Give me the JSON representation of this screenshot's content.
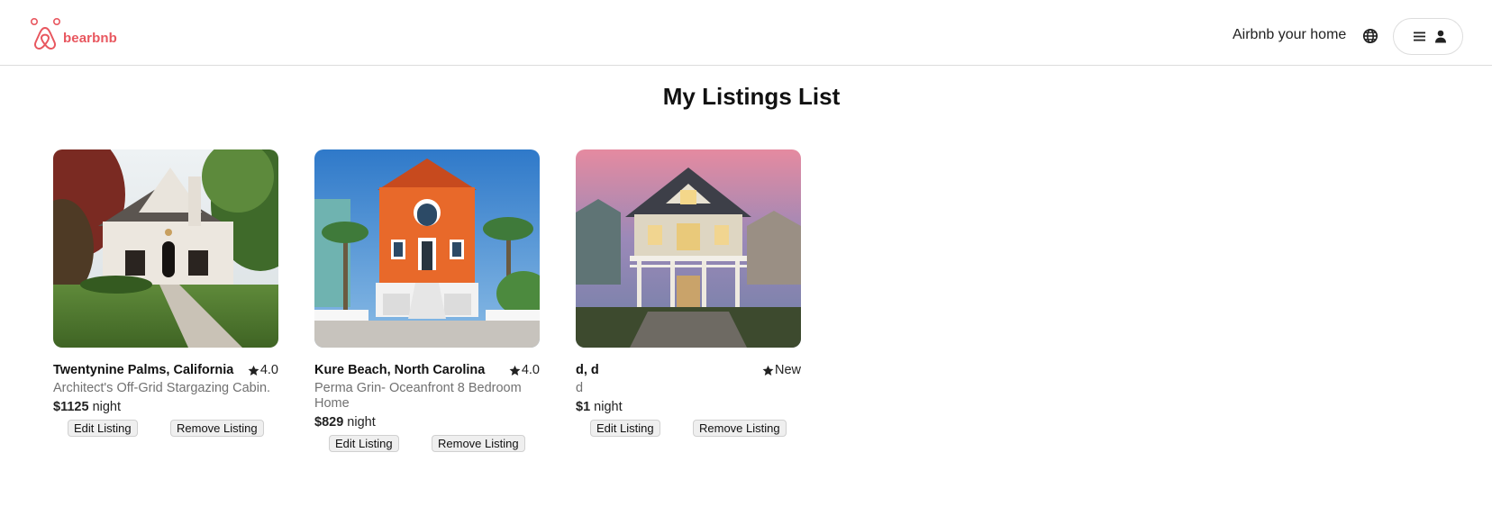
{
  "header": {
    "brand": "bearbnb",
    "host_link": "Airbnb your home",
    "brand_color": "#e8575f"
  },
  "page": {
    "title": "My Listings List"
  },
  "listings": [
    {
      "location": "Twentynine Palms, California",
      "rating": "4.0",
      "description": "Architect's Off-Grid Stargazing Cabin.",
      "price": "$1125",
      "price_unit": "night",
      "edit_label": "Edit Listing",
      "remove_label": "Remove Listing"
    },
    {
      "location": "Kure Beach, North Carolina",
      "rating": "4.0",
      "description": "Perma Grin- Oceanfront 8 Bedroom Home",
      "price": "$829",
      "price_unit": "night",
      "edit_label": "Edit Listing",
      "remove_label": "Remove Listing"
    },
    {
      "location": "d, d",
      "rating": "New",
      "description": "d",
      "price": "$1",
      "price_unit": "night",
      "edit_label": "Edit Listing",
      "remove_label": "Remove Listing"
    }
  ]
}
